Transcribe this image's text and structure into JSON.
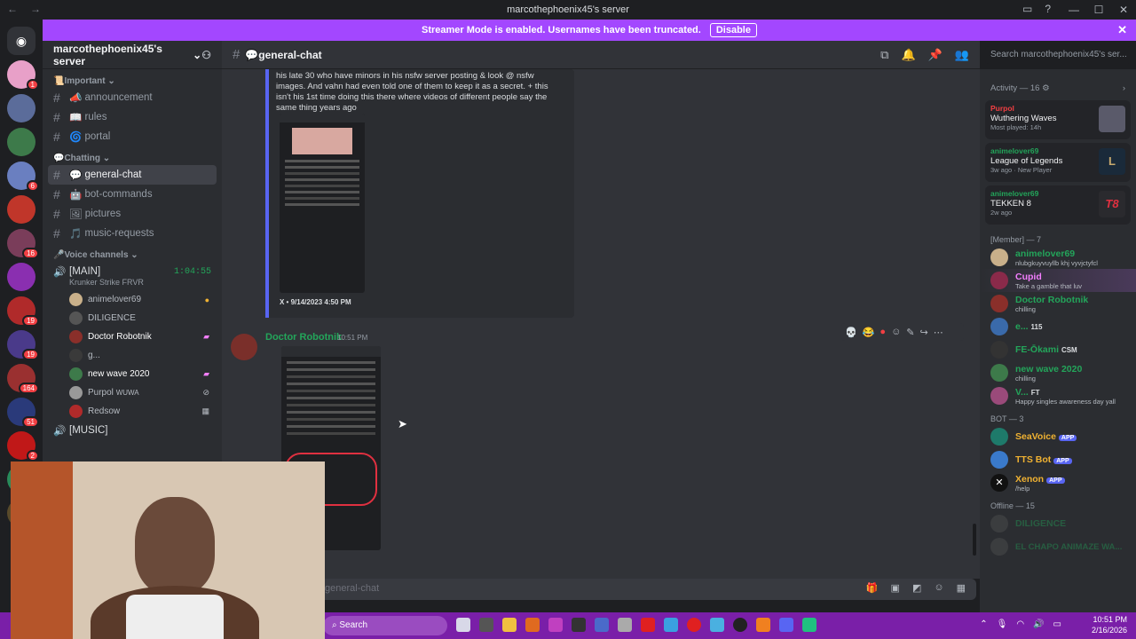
{
  "window": {
    "title": "marcothephoenix45's server"
  },
  "banner": {
    "text": "Streamer Mode is enabled. Usernames have been truncated.",
    "button": "Disable"
  },
  "server": {
    "name": "marcothephoenix45's server"
  },
  "categories": {
    "important": "Important",
    "chatting": "Chatting",
    "voice": "Voice channels"
  },
  "channels": {
    "announcement": "announcement",
    "rules": "rules",
    "portal": "portal",
    "general": "general-chat",
    "bot": "bot-commands",
    "pictures": "pictures",
    "music": "music-requests"
  },
  "voice": {
    "main": "[MAIN]",
    "main_time": "1:04:55",
    "main_sub": "Krunker Strike FRVR",
    "music": "[MUSIC]",
    "users": [
      "animelover69",
      "DILIGENCE",
      "Doctor Robotnik",
      "g...",
      "new wave 2020",
      "Purpol",
      "Redsow"
    ],
    "purpol_tag": "WUWA"
  },
  "topbar": {
    "channel": "general-chat",
    "search_placeholder": "Search marcothephoenix45's ser..."
  },
  "embed": {
    "text": "his late 30 who have minors in his nsfw server posting & look @ nsfw images. And vahn had even told one of them to keep it as a secret. + this isn't his 1st time doing this there where videos of different people say the same thing years ago",
    "footer": "X • 9/14/2023 4:50 PM"
  },
  "message": {
    "author": "Doctor Robotnik",
    "time": "10:51 PM"
  },
  "composer": {
    "placeholder": "general-chat"
  },
  "activity": {
    "header": "Activity — 16",
    "cards": [
      {
        "who": "Purpol",
        "game": "Wuthering Waves",
        "sub": "Most played: 14h",
        "color": "#f23f43"
      },
      {
        "who": "animelover69",
        "game": "League of Legends",
        "sub": "3w ago  ·  New Player",
        "color": "#23a55a"
      },
      {
        "who": "animelover69",
        "game": "TEKKEN 8",
        "sub": "2w ago",
        "color": "#23a55a"
      }
    ]
  },
  "members": {
    "member_header": "[Member] — 7",
    "list": [
      {
        "name": "animelover69",
        "status": "nlubgkuyvuyllb khj vyvjctyfcl",
        "color": "#23a55a"
      },
      {
        "name": "Cupid",
        "status": "Take a gamble that luv",
        "color": "#f47fff"
      },
      {
        "name": "Doctor Robotnik",
        "status": "chilling",
        "color": "#23a55a"
      },
      {
        "name": "e...",
        "status": "",
        "color": "#23a55a"
      },
      {
        "name": "FE-Ōkami",
        "status": "",
        "color": "#23a55a"
      },
      {
        "name": "new wave 2020",
        "status": "chilling",
        "color": "#23a55a"
      },
      {
        "name": "V...",
        "status": "Happy singles awareness day yall",
        "color": "#23a55a"
      }
    ],
    "e_tag": "115",
    "okami_tag": "CSM",
    "v_tag": "FT",
    "bot_header": "BOT — 3",
    "bots": [
      {
        "name": "SeaVoice",
        "sub": "",
        "color": "#f0b232"
      },
      {
        "name": "TTS Bot",
        "sub": "",
        "color": "#f0b232"
      },
      {
        "name": "Xenon",
        "sub": "/help",
        "color": "#f0b232"
      }
    ],
    "app_tag": "APP",
    "offline_header": "Offline — 15",
    "offline": [
      "DILIGENCE",
      "EL CHAPO ANIMAZE WA..."
    ]
  },
  "taskbar": {
    "search": "Search",
    "time": "10:51 PM",
    "date": "2/16/2026"
  }
}
